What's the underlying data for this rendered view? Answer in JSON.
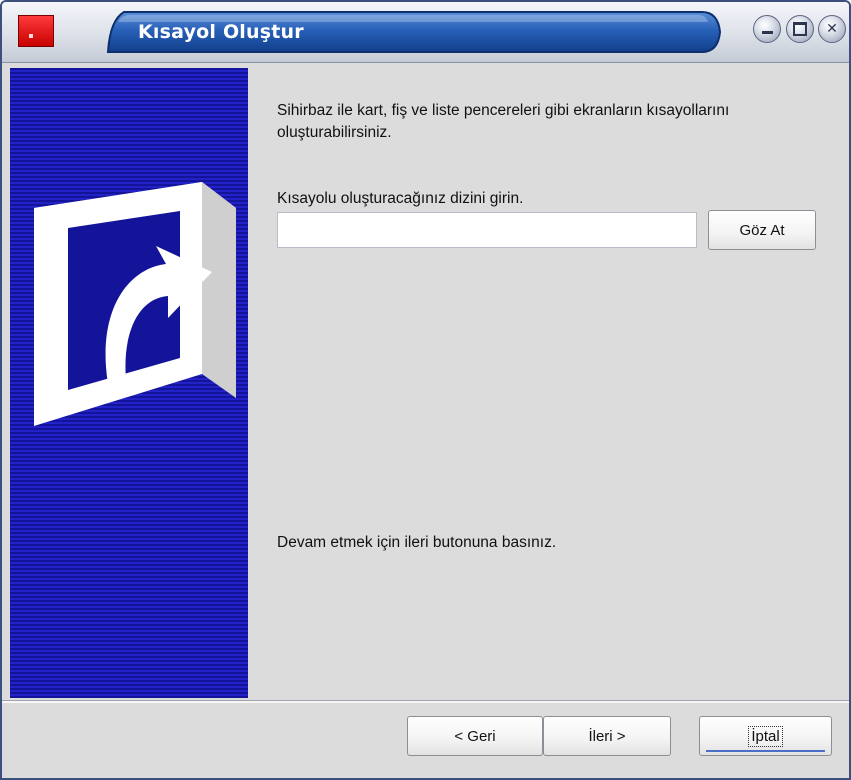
{
  "window": {
    "title": "Kısayol Oluştur"
  },
  "content": {
    "intro": "Sihirbaz ile kart, fiş ve liste pencereleri gibi ekranların kısayollarını oluşturabilirsiniz.",
    "directory_label": "Kısayolu oluşturacağınız dizini girin.",
    "directory_value": "",
    "browse_label": "Göz At",
    "continue_hint": "Devam etmek için ileri butonuna basınız."
  },
  "footer": {
    "back_label": "< Geri",
    "next_label": "İleri >",
    "cancel_label": "İptal"
  },
  "icons": {
    "app": "app-icon",
    "banner": "shortcut-arrow-icon",
    "minimize": "minimize-icon",
    "maximize": "maximize-icon",
    "close": "close-icon"
  },
  "colors": {
    "title_bar": "#1f4f9f",
    "banner_dark": "#14149a",
    "banner_light": "#2222c6",
    "dialog_bg": "#dcdcdc"
  }
}
